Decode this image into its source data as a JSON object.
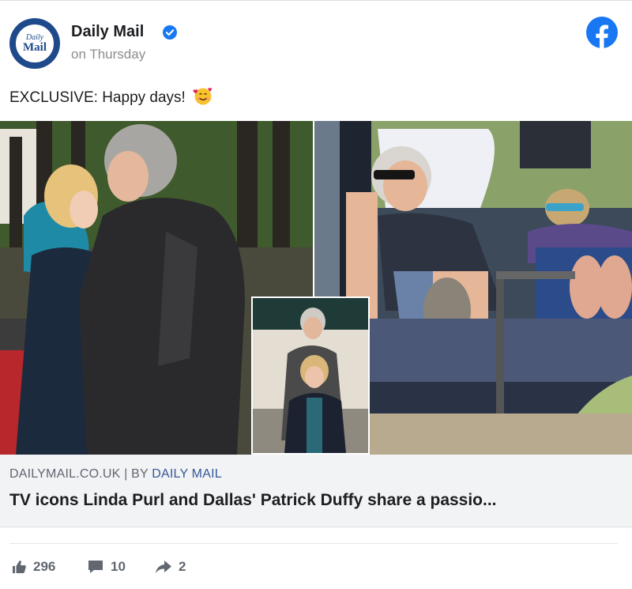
{
  "header": {
    "page_name": "Daily Mail",
    "post_time": "on Thursday",
    "logo": {
      "line1": "Daily",
      "line2": "Mail"
    },
    "brand_color": "#1877f2",
    "logo_color": "#1e4a8c"
  },
  "post": {
    "caption": "EXCLUSIVE: Happy days!",
    "caption_emoji": "smiling-face-with-hearts"
  },
  "link_preview": {
    "domain": "DAILYMAIL.CO.UK",
    "separator": " | BY ",
    "author": "DAILY MAIL",
    "title": "TV icons Linda Purl and Dallas' Patrick Duffy share a passio..."
  },
  "stats": {
    "likes": "296",
    "comments": "10",
    "shares": "2"
  },
  "icons": [
    "verified-icon",
    "facebook-icon",
    "like-icon",
    "comment-icon",
    "share-icon"
  ]
}
